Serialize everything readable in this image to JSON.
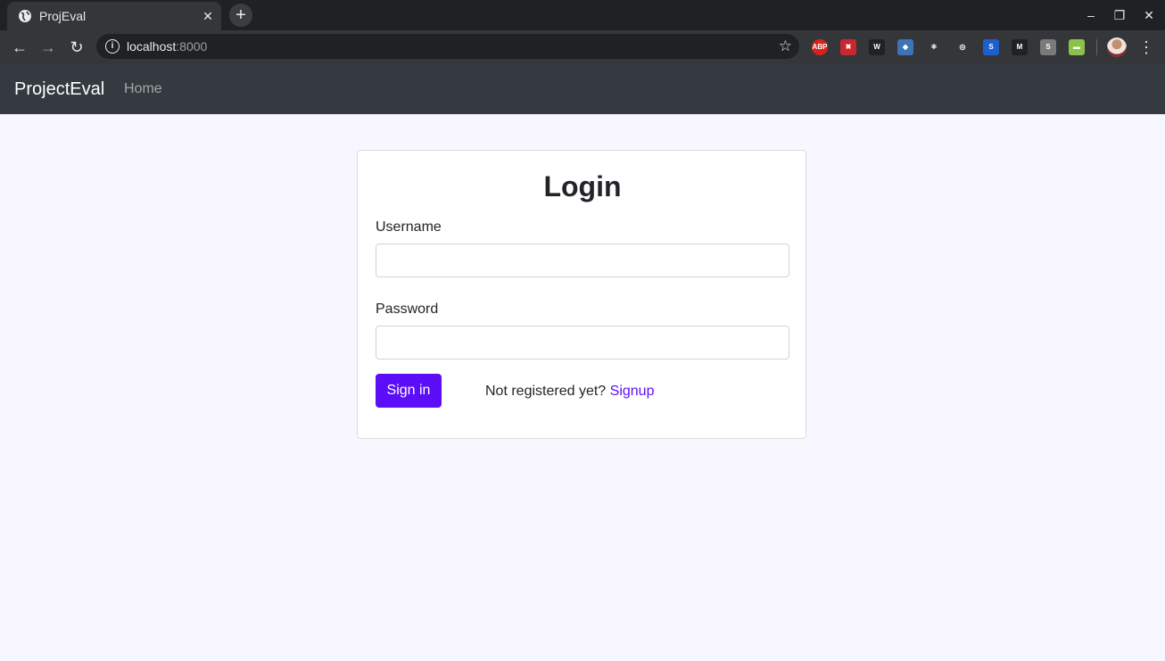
{
  "browser": {
    "tab_title": "ProjEval",
    "tab_close": "✕",
    "new_tab": "+",
    "window_controls": {
      "minimize": "–",
      "restore": "❐",
      "close": "✕"
    },
    "nav": {
      "back": "←",
      "forward": "→",
      "reload": "↻"
    },
    "url_host": "localhost",
    "url_port": ":8000",
    "bookmark": "☆",
    "menu": "⋮",
    "extensions": [
      {
        "name": "adblock-plus-icon",
        "label": "ABP",
        "color": "#d6231c"
      },
      {
        "name": "extension-red-icon",
        "label": "✖",
        "color": "#c8282d"
      },
      {
        "name": "extension-w-icon",
        "label": "W",
        "color": "#202124"
      },
      {
        "name": "python-icon",
        "label": "◆",
        "color": "#3b74b7"
      },
      {
        "name": "react-devtools-icon",
        "label": "⚛",
        "color": "#35363a"
      },
      {
        "name": "target-icon",
        "label": "◎",
        "color": "#35363a"
      },
      {
        "name": "extension-s-blue-icon",
        "label": "S",
        "color": "#1e5fd0"
      },
      {
        "name": "extension-m-icon",
        "label": "M",
        "color": "#202124"
      },
      {
        "name": "extension-s-gray-icon",
        "label": "S",
        "color": "#7a7a7a"
      },
      {
        "name": "extension-green-icon",
        "label": "▬",
        "color": "#8bc34a"
      }
    ]
  },
  "navbar": {
    "brand": "ProjectEval",
    "links": [
      "Home"
    ]
  },
  "login": {
    "title": "Login",
    "username_label": "Username",
    "username_value": "",
    "password_label": "Password",
    "password_value": "",
    "submit_label": "Sign in",
    "signup_prompt": "Not registered yet?",
    "signup_link": "Signup"
  },
  "colors": {
    "page_bg": "#f8f6ff",
    "navbar_bg": "#343a40",
    "accent": "#5b0ef7"
  }
}
